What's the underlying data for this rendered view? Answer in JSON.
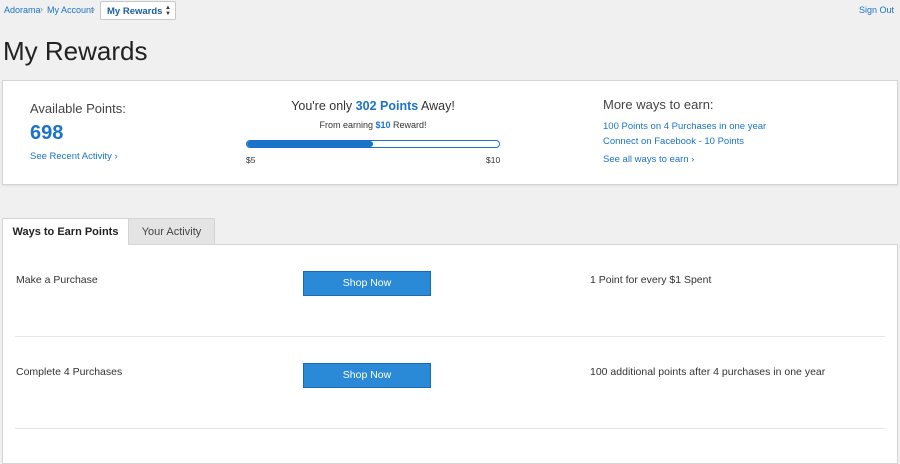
{
  "breadcrumb": {
    "items": [
      "Adorama",
      "My Account"
    ],
    "separator": "›",
    "current": "My Rewards",
    "current_arrow_up": "▲",
    "current_arrow_down": "▼"
  },
  "header": {
    "sign_out": "Sign Out"
  },
  "page": {
    "title": "My Rewards"
  },
  "summary": {
    "available_label": "Available Points:",
    "available_value": "698",
    "recent_activity_link": "See Recent Activity ›",
    "progress": {
      "prefix": "You're only ",
      "points": "302 Points",
      "suffix": " Away!",
      "sub_prefix": "From earning ",
      "sub_amount": "$10",
      "sub_suffix": " Reward!",
      "min_label": "$5",
      "max_label": "$10",
      "fill_fraction": 0.5
    },
    "more": {
      "title": "More ways to earn:",
      "links": [
        "100 Points on 4 Purchases in one year",
        "Connect on Facebook - 10 Points",
        "See all ways to earn ›"
      ]
    }
  },
  "tabs": [
    {
      "label": "Ways to Earn Points",
      "active": true
    },
    {
      "label": "Your Activity",
      "active": false
    }
  ],
  "earn_rows": [
    {
      "title": "Make a Purchase",
      "button": "Shop Now",
      "description": "1 Point for every $1 Spent"
    },
    {
      "title": "Complete 4 Purchases",
      "button": "Shop Now",
      "description": "100 additional points after 4 purchases in one year"
    }
  ],
  "colors": {
    "accent": "#1a73c9",
    "button": "#2b8ad8",
    "background": "#f0f0f0"
  }
}
